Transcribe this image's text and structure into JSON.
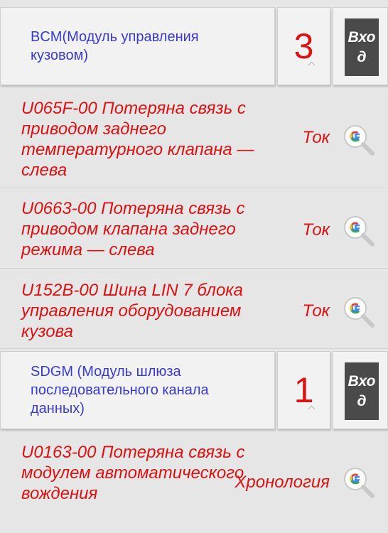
{
  "modules": [
    {
      "name": "BCM(Модуль управления кузовом)",
      "count": "3",
      "enter_label": "Вход",
      "faults": [
        {
          "code_text": "U065F-00 Потеряна связь с приводом заднего температурного клапана — слева",
          "status": "Ток"
        },
        {
          "code_text": "U0663-00 Потеряна связь с приводом клапана заднего режима — слева",
          "status": "Ток"
        },
        {
          "code_text": "U152B-00 Шина LIN 7 блока управления оборудованием кузова",
          "status": "Ток"
        }
      ]
    },
    {
      "name": "SDGM (Модуль шлюза последовательного канала данных)",
      "count": "1",
      "enter_label": "Вход",
      "faults": [
        {
          "code_text": "U0163-00 Потеряна связь с модулем автоматического вождения",
          "status": "Хронология"
        }
      ]
    }
  ],
  "colors": {
    "module_name": "#3a3ad0",
    "fault_red": "#dd1111",
    "enter_button_bg": "#4a4a4a"
  },
  "icons": {
    "search": "google-search-icon"
  }
}
